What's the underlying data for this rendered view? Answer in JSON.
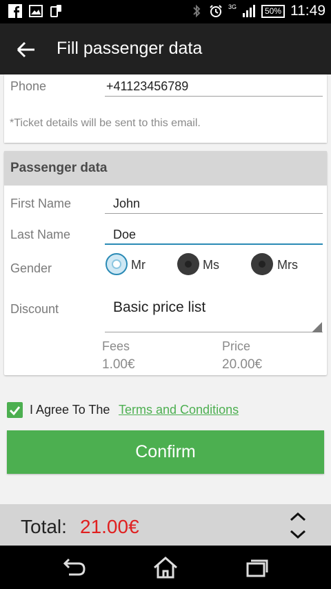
{
  "status_bar": {
    "network": "3G",
    "battery": "50%",
    "time": "11:49",
    "left_icons": [
      "facebook-icon",
      "image-icon",
      "phone-sync-icon"
    ],
    "right_icons": [
      "bluetooth-icon",
      "alarm-icon",
      "signal-icon"
    ]
  },
  "app_bar": {
    "title": "Fill passenger data",
    "back_icon": "arrow-left-icon"
  },
  "contact": {
    "phone_label": "Phone",
    "phone_value": "+41123456789",
    "hint": "*Ticket details will be sent to this email."
  },
  "passenger": {
    "section_title": "Passenger data",
    "first_name_label": "First Name",
    "first_name_value": "John",
    "last_name_label": "Last Name",
    "last_name_value": "Doe",
    "gender_label": "Gender",
    "gender_options": [
      {
        "label": "Mr",
        "selected": true
      },
      {
        "label": "Ms",
        "selected": false
      },
      {
        "label": "Mrs",
        "selected": false
      }
    ],
    "discount_label": "Discount",
    "discount_value": "Basic price list",
    "fees_label": "Fees",
    "fees_value": "1.00€",
    "price_label": "Price",
    "price_value": "20.00€"
  },
  "agreement": {
    "checked": true,
    "text": "I Agree To The",
    "link": "Terms and Conditions"
  },
  "confirm_label": "Confirm",
  "total": {
    "label": "Total:",
    "value": "21.00€"
  },
  "colors": {
    "accent_green": "#4caf50",
    "focus_blue": "#2a8ab5",
    "total_red": "#e02020",
    "app_bar": "#212121"
  }
}
